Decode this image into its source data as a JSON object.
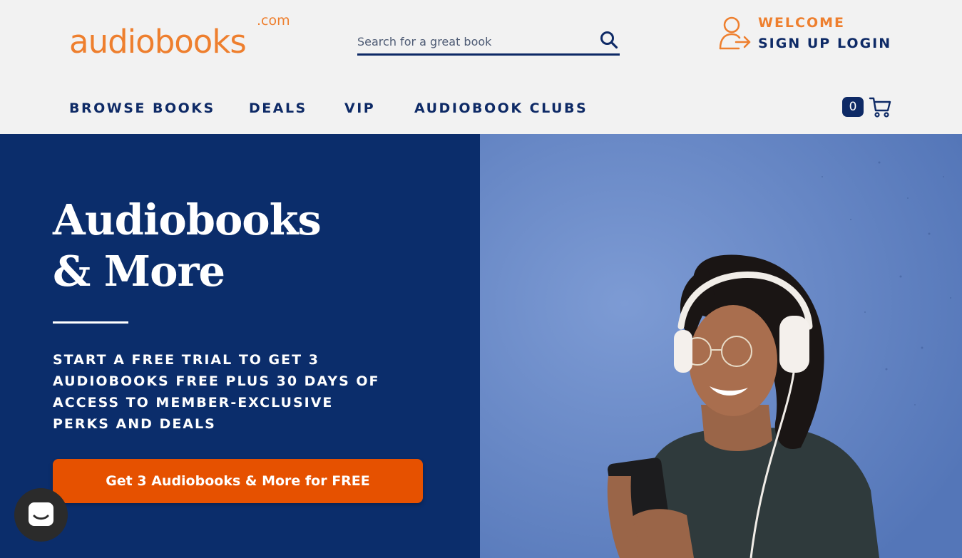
{
  "brand": {
    "logo_text": "audiobooks",
    "logo_suffix": ".com",
    "color_orange": "#ee7f2e",
    "color_navy": "#0e2a66"
  },
  "search": {
    "placeholder": "Search for a great book",
    "value": ""
  },
  "account": {
    "welcome": "WELCOME",
    "signup": "SIGN UP",
    "login": "LOGIN"
  },
  "nav": {
    "items": [
      {
        "label": "BROWSE BOOKS"
      },
      {
        "label": "DEALS"
      },
      {
        "label": "VIP"
      },
      {
        "label": "AUDIOBOOK CLUBS"
      }
    ]
  },
  "cart": {
    "count": "0"
  },
  "hero": {
    "title_line1": "Audiobooks",
    "title_line2": "& More",
    "subtitle": "START A FREE TRIAL TO GET 3 AUDIOBOOKS FREE PLUS 30 DAYS OF ACCESS TO MEMBER-EXCLUSIVE PERKS AND DEALS",
    "cta_label": "Get 3 Audiobooks & More for FREE",
    "cta_color": "#e65100",
    "panel_color": "#0b2d6b"
  },
  "icons": {
    "search": "search-icon",
    "user": "user-arrow-icon",
    "cart": "cart-icon",
    "chat": "chat-icon"
  }
}
